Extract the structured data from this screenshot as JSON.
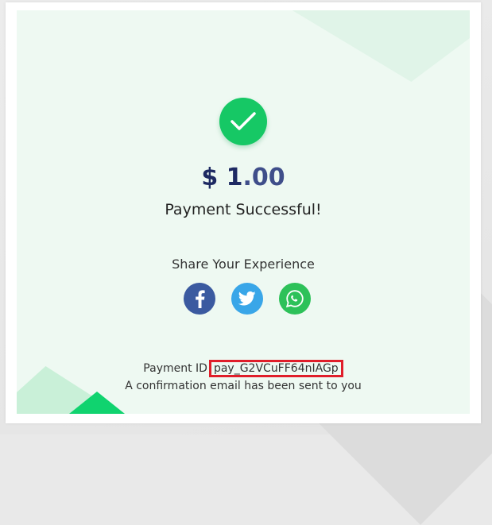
{
  "payment": {
    "currency_symbol": "$ 1",
    "amount_cents": ".00",
    "status": "Payment Successful!",
    "share_label": "Share Your Experience",
    "payment_id_label": "Payment ID",
    "payment_id": "pay_G2VCuFF64nIAGp",
    "confirmation": "A confirmation email has been sent to you"
  },
  "social": [
    "facebook-icon",
    "twitter-icon",
    "whatsapp-icon"
  ],
  "colors": {
    "success_green": "#16c865",
    "amount_blue": "#1e2a63",
    "facebook": "#3b5aa0",
    "twitter": "#39a6e8",
    "whatsapp": "#2dc159",
    "highlight_red": "#e01e2a"
  }
}
